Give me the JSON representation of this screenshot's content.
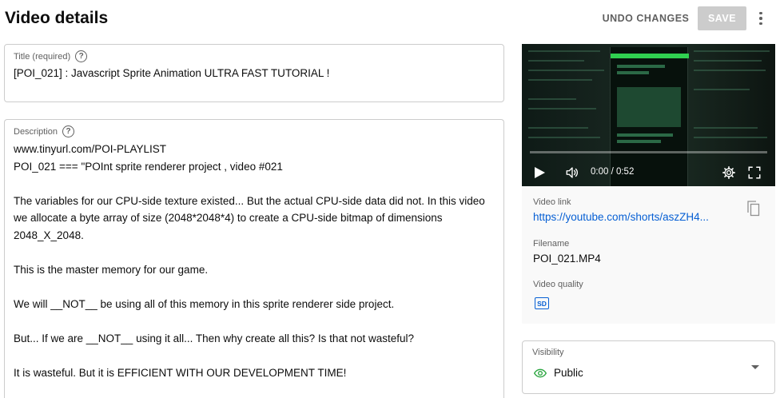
{
  "header": {
    "title": "Video details",
    "undo_label": "UNDO CHANGES",
    "save_label": "SAVE",
    "more_icon": "more-vert-icon"
  },
  "title_field": {
    "label": "Title (required)",
    "value": "[POI_021] : Javascript Sprite Animation ULTRA FAST TUTORIAL !"
  },
  "description": {
    "label": "Description",
    "lines": [
      "www.tinyurl.com/POI-PLAYLIST",
      "POI_021 === \"POInt sprite renderer project , video #021",
      "The variables for our CPU-side texture existed... But the actual CPU-side data did not. In this video we allocate a byte array of size (2048*2048*4) to create a CPU-side bitmap of dimensions 2048_X_2048.",
      "This is the master memory for our game.",
      "We will __NOT__ be using all of this memory in this sprite renderer side project.",
      "But... If we are __NOT__ using it all... Then why create all this? Is that not wasteful?",
      "It is wasteful. But it is EFFICIENT WITH OUR DEVELOPMENT TIME!"
    ]
  },
  "video": {
    "time": "0:00 / 0:52",
    "link_label": "Video link",
    "link": "https://youtube.com/shorts/aszZH4...",
    "filename_label": "Filename",
    "filename": "POI_021.MP4",
    "quality_label": "Video quality",
    "quality_badge": "SD"
  },
  "visibility": {
    "label": "Visibility",
    "value": "Public",
    "icon": "eye-icon",
    "icon_color": "#2ba640"
  },
  "colors": {
    "link": "#065fd4",
    "save_disabled_bg": "#cccccc"
  }
}
